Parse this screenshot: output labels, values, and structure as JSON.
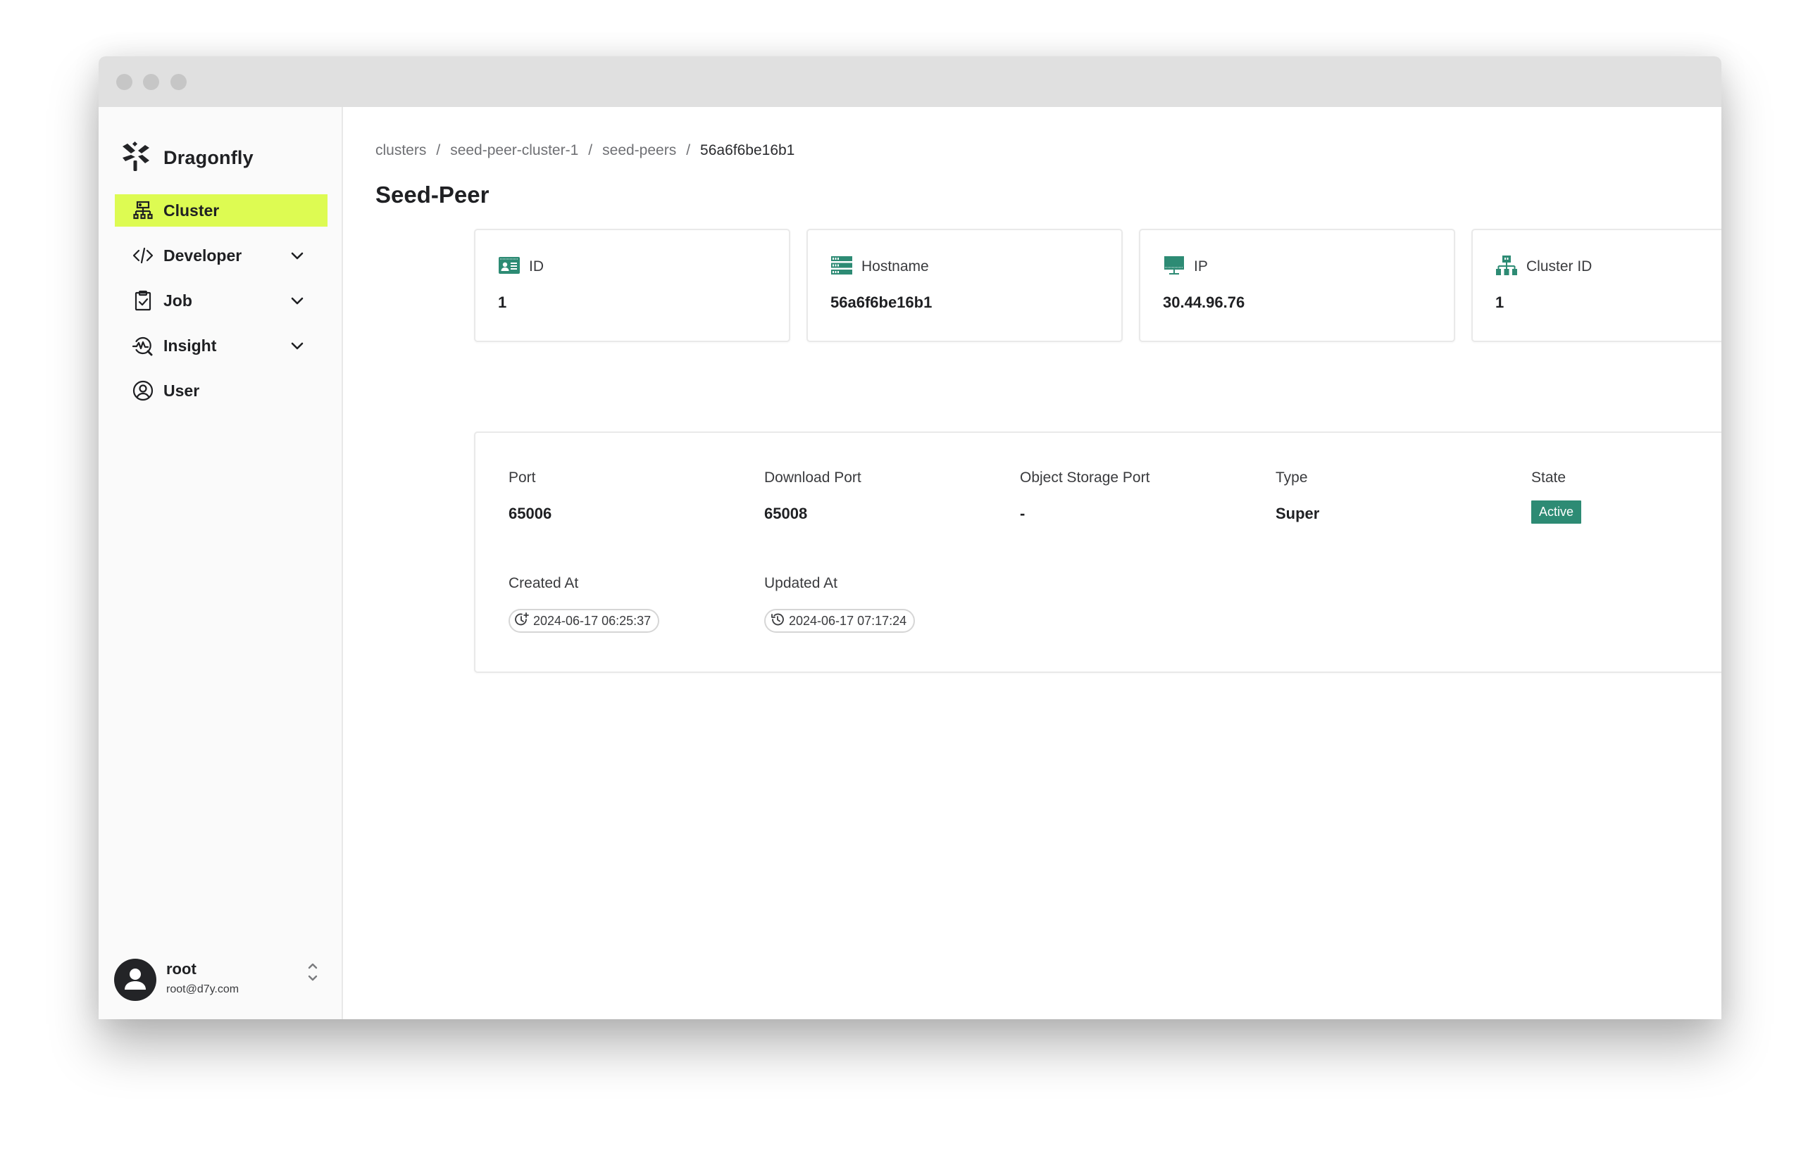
{
  "window": {
    "controls": [
      "close",
      "minimize",
      "maximize"
    ]
  },
  "sidebar": {
    "brand": {
      "name": "Dragonfly",
      "icon": "dragonfly-logo-icon"
    },
    "items": [
      {
        "label": "Cluster",
        "icon": "cluster-icon",
        "active": true,
        "expandable": false
      },
      {
        "label": "Developer",
        "icon": "code-icon",
        "active": false,
        "expandable": true
      },
      {
        "label": "Job",
        "icon": "clipboard-check-icon",
        "active": false,
        "expandable": true
      },
      {
        "label": "Insight",
        "icon": "insight-icon",
        "active": false,
        "expandable": true
      },
      {
        "label": "User",
        "icon": "user-circle-icon",
        "active": false,
        "expandable": false
      }
    ],
    "user": {
      "name": "root",
      "email": "root@d7y.com",
      "toggle_icon": "unfold-icon"
    }
  },
  "main": {
    "breadcrumb": [
      {
        "label": "clusters"
      },
      {
        "label": "seed-peer-cluster-1"
      },
      {
        "label": "seed-peers"
      },
      {
        "label": "56a6f6be16b1"
      }
    ],
    "breadcrumb_separator": "/",
    "title": "Seed-Peer",
    "info_cards": [
      {
        "label": "ID",
        "value": "1",
        "icon": "id-card-icon"
      },
      {
        "label": "Hostname",
        "value": "56a6f6be16b1",
        "icon": "server-icon"
      },
      {
        "label": "IP",
        "value": "30.44.96.76",
        "icon": "monitor-icon"
      },
      {
        "label": "Cluster ID",
        "value": "1",
        "icon": "hierarchy-icon"
      }
    ],
    "details": {
      "port": {
        "label": "Port",
        "value": "65006"
      },
      "download_port": {
        "label": "Download Port",
        "value": "65008"
      },
      "object_storage_port": {
        "label": "Object Storage Port",
        "value": "-"
      },
      "type": {
        "label": "Type",
        "value": "Super"
      },
      "state": {
        "label": "State",
        "value": "Active",
        "color": "#2d8b74"
      },
      "created_at": {
        "label": "Created At",
        "value": "2024-06-17 06:25:37",
        "icon": "clock-plus-icon"
      },
      "updated_at": {
        "label": "Updated At",
        "value": "2024-06-17 07:17:24",
        "icon": "history-icon"
      }
    }
  },
  "colors": {
    "accent_active_nav": "#ddfb52",
    "brand_green": "#2d8b74",
    "text_primary": "#1f2023",
    "text_secondary": "#6f7074"
  }
}
